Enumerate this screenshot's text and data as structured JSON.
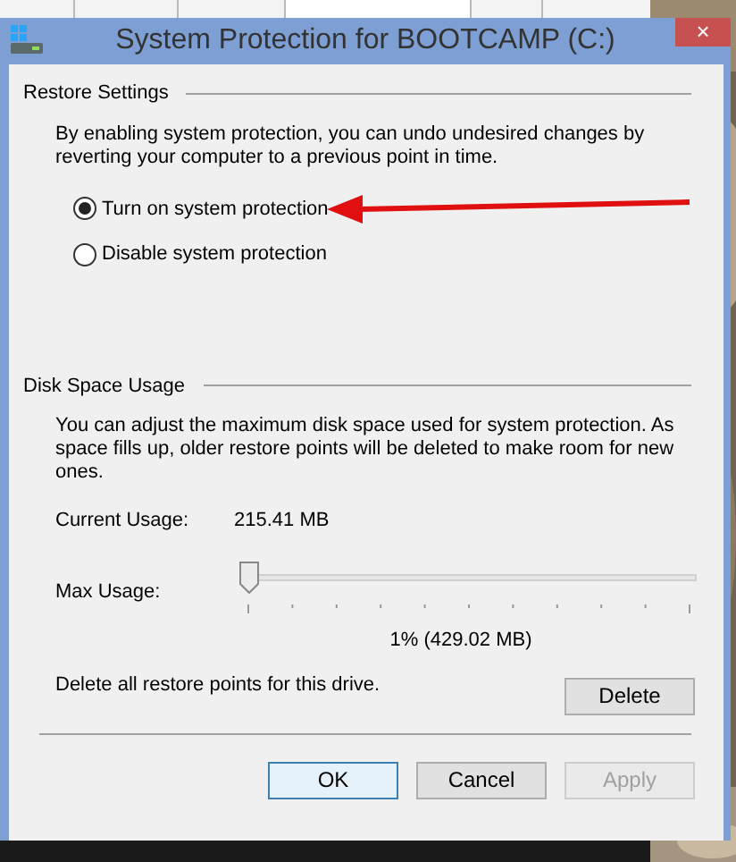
{
  "window": {
    "title": "System Protection for BOOTCAMP (C:)",
    "close": "×"
  },
  "restore_settings": {
    "heading": "Restore Settings",
    "description": "By enabling system protection, you can undo undesired changes by reverting your computer to a previous point in time.",
    "options": [
      {
        "label": "Turn on system protection",
        "selected": true
      },
      {
        "label": "Disable system protection",
        "selected": false
      }
    ]
  },
  "disk_space_usage": {
    "heading": "Disk Space Usage",
    "description": "You can adjust the maximum disk space used for system protection. As space fills up, older restore points will be deleted to make room for new ones.",
    "current_usage_label": "Current Usage:",
    "current_usage_value": "215.41 MB",
    "max_usage_label": "Max Usage:",
    "max_usage": {
      "level": 0.0
    },
    "max_usage_reading": "1% (429.02 MB)",
    "delete_text": "Delete all restore points for this drive.",
    "delete_button": "Delete"
  },
  "buttons": [
    {
      "label": "OK",
      "kind": "default",
      "disabled": false
    },
    {
      "label": "Cancel",
      "kind": "normal",
      "disabled": false
    },
    {
      "label": "Apply",
      "kind": "normal",
      "disabled": true
    }
  ]
}
